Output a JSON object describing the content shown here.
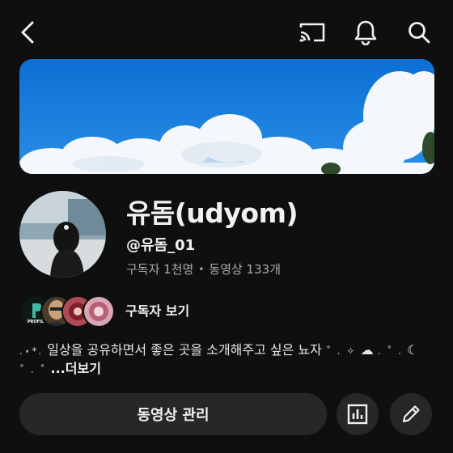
{
  "header": {
    "back_icon": "chevron-left-icon",
    "cast_icon": "cast-icon",
    "notifications_icon": "bell-icon",
    "search_icon": "search-icon"
  },
  "channel": {
    "name": "유돔(udyom)",
    "handle": "@유돔_01",
    "subscribers": "구독자 1천명",
    "separator": "•",
    "videos": "동영상 133개"
  },
  "subscribers_section": {
    "label": "구독자 보기",
    "first_avatar_text": "PROFIL"
  },
  "description": {
    "text": "일상을 공유하면서 좋은 곳을 소개해주고 싶은 뇨자",
    "more_label": "...더보기"
  },
  "actions": {
    "manage_videos_label": "동영상 관리",
    "analytics_icon": "bar-chart-icon",
    "edit_icon": "pencil-icon"
  },
  "colors": {
    "background": "#0f0f0f",
    "button_bg": "#272727",
    "text_primary": "#f1f1f1",
    "text_secondary": "#aaaaaa"
  }
}
